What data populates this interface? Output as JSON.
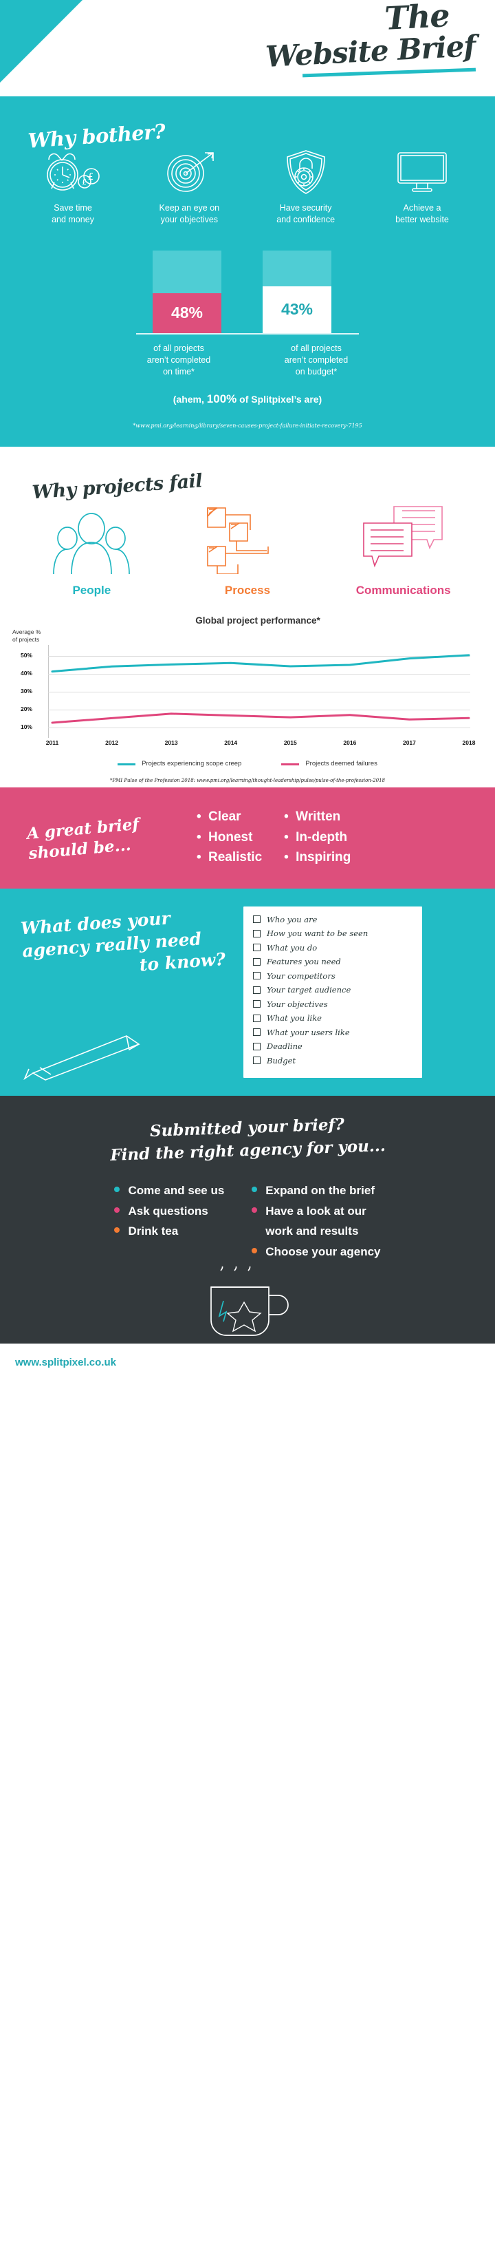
{
  "colors": {
    "teal": "#22bcc5",
    "teal_dark": "#22a8b2",
    "teal_light": "#4fcdd4",
    "pink": "#dd4f7c",
    "orange": "#f47b33",
    "dark": "#33393c",
    "white": "#ffffff"
  },
  "header": {
    "title_line1": "The",
    "title_line2": "Website Brief"
  },
  "why_bother": {
    "heading": "Why bother?",
    "items": [
      {
        "icon": "alarm-clock-money-icon",
        "caption": "Save time\nand money"
      },
      {
        "icon": "target-arrow-icon",
        "caption": "Keep an eye on\nyour objectives"
      },
      {
        "icon": "shield-padlock-icon",
        "caption": "Have security\nand confidence"
      },
      {
        "icon": "monitor-icon",
        "caption": "Achieve a\nbetter website"
      }
    ],
    "bars": [
      {
        "value": "48%",
        "caption": "of all projects\naren’t completed\non time*",
        "style": "pink"
      },
      {
        "value": "43%",
        "caption": "of all projects\naren’t completed\non budget*",
        "style": "white"
      }
    ],
    "ahem_prefix": "(ahem,",
    "ahem_number": "100%",
    "ahem_suffix": "of Splitpixel’s are)",
    "source": "*www.pmi.org/learning/library/seven-causes-project-failure-initiate-recovery-7195"
  },
  "why_fail": {
    "heading": "Why projects fail",
    "items": [
      {
        "icon": "people-group-icon",
        "label": "People",
        "color": "#1fb6c1"
      },
      {
        "icon": "process-flowchart-icon",
        "label": "Process",
        "color": "#f47b33"
      },
      {
        "icon": "speech-bubbles-icon",
        "label": "Communications",
        "color": "#e0467c"
      }
    ]
  },
  "chart_data": {
    "type": "line",
    "title": "Global project performance*",
    "ylabel": "Average %\nof projects",
    "xlabel": "",
    "x": [
      "2011",
      "2012",
      "2013",
      "2014",
      "2015",
      "2016",
      "2017",
      "2018"
    ],
    "yticks": [
      "10%",
      "20%",
      "30%",
      "40%",
      "50%"
    ],
    "ytick_values": [
      10,
      20,
      30,
      40,
      50
    ],
    "ylim": [
      8,
      54
    ],
    "grid": true,
    "legend_position": "bottom",
    "series": [
      {
        "name": "Projects experiencing scope creep",
        "color": "#1fb6c1",
        "values": [
          41.5,
          44.3,
          45.4,
          46.2,
          44.4,
          45.2,
          48.8,
          50.6
        ]
      },
      {
        "name": "Projects deemed failures",
        "color": "#e0467c",
        "values": [
          13.0,
          15.5,
          18.0,
          17.0,
          16.0,
          17.3,
          14.8,
          15.6
        ]
      }
    ],
    "source": "*PMI Pulse of the Profession 2018: www.pmi.org/learning/thought-leadership/pulse/pulse-of-the-profession-2018"
  },
  "great_brief": {
    "heading": "A great brief should be...",
    "column1": [
      "Clear",
      "Honest",
      "Realistic"
    ],
    "column2": [
      "Written",
      "In-depth",
      "Inspiring"
    ]
  },
  "agency_needs": {
    "heading_line1": "What does your agency really need",
    "heading_line2": "to know?",
    "checklist": [
      "Who you are",
      "How you want to be seen",
      "What you do",
      "Features you need",
      "Your competitors",
      "Your target audience",
      "Your objectives",
      "What you like",
      "What your users like",
      "Deadline",
      "Budget"
    ]
  },
  "next_steps": {
    "heading_line1": "Submitted your brief?",
    "heading_line2": "Find the right agency for you...",
    "column1": [
      {
        "label": "Come and see us",
        "color": "#22bcc5"
      },
      {
        "label": "Ask questions",
        "color": "#e0467c"
      },
      {
        "label": "Drink tea",
        "color": "#f47b33"
      }
    ],
    "column2": [
      {
        "label": "Expand on the brief",
        "color": "#22bcc5"
      },
      {
        "label": "Have a look at our\nwork and results",
        "color": "#e0467c"
      },
      {
        "label": "Choose your agency",
        "color": "#f47b33"
      }
    ]
  },
  "footer": {
    "url": "www.splitpixel.co.uk"
  }
}
